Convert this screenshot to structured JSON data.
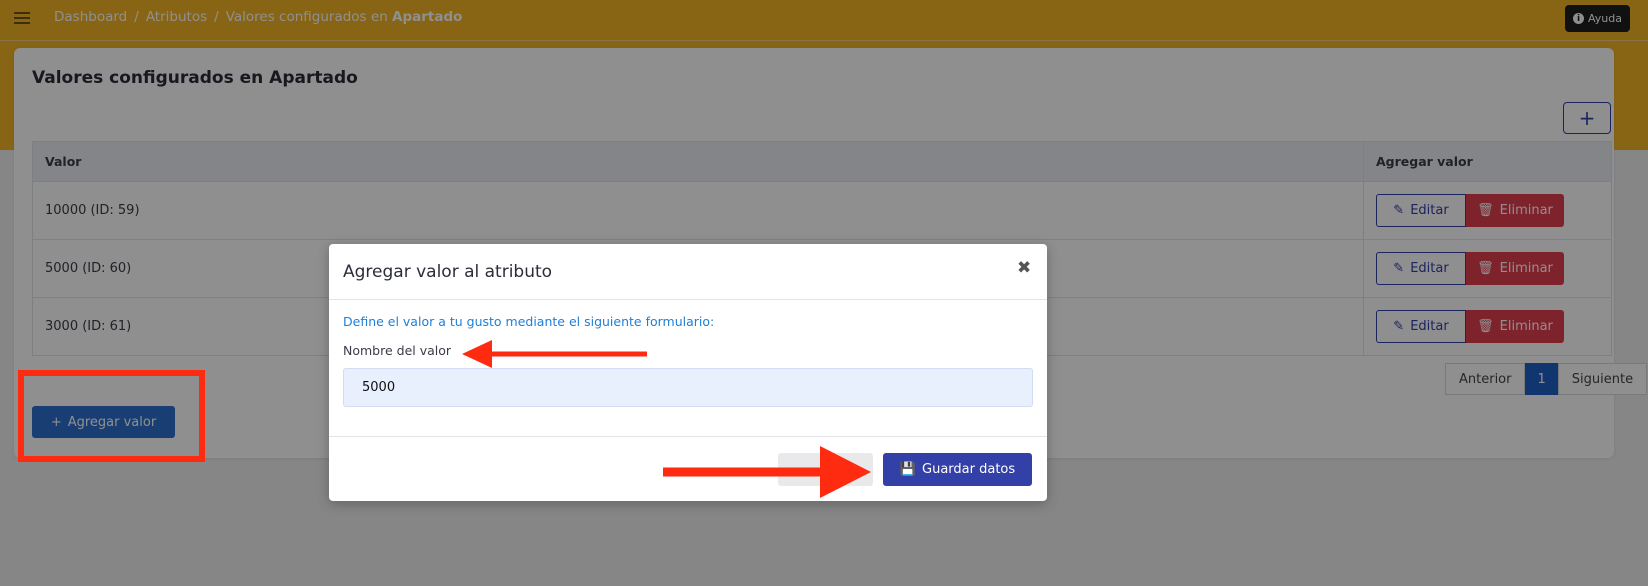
{
  "breadcrumb": {
    "items": [
      "Dashboard",
      "Atributos"
    ],
    "current_prefix": "Valores configurados en ",
    "current_bold": "Apartado"
  },
  "header": {
    "help_label": "Ayuda"
  },
  "card": {
    "title": "Valores configurados en Apartado",
    "add_symbol": "+",
    "table": {
      "columns": [
        "Valor",
        "Agregar valor"
      ],
      "rows": [
        {
          "valor": "10000 (ID: 59)"
        },
        {
          "valor": "5000 (ID: 60)"
        },
        {
          "valor": "3000 (ID: 61)"
        }
      ],
      "edit_label": "Editar",
      "delete_label": "Eliminar"
    },
    "pager": {
      "prev": "Anterior",
      "page": "1",
      "next": "Siguiente"
    },
    "add_value_label": "Agregar valor"
  },
  "modal": {
    "title": "Agregar valor al atributo",
    "close_symbol": "✖",
    "description": "Define el valor a tu gusto mediante el siguiente formulario:",
    "field_label": "Nombre del valor",
    "field_value": "5000",
    "cancel_symbol": "✖",
    "save_label": "Guardar datos"
  },
  "colors": {
    "brand_yellow": "#f0b527",
    "primary": "#3340a8",
    "danger": "#e03e4f",
    "annotation": "#ff2b10"
  }
}
